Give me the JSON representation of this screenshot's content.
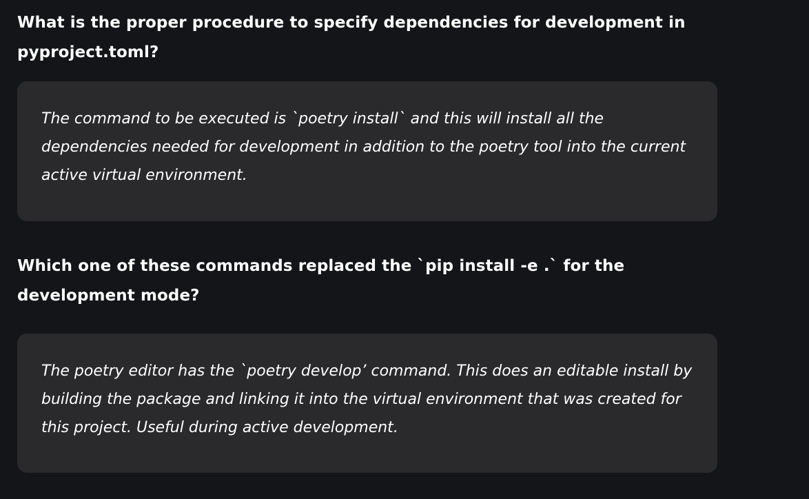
{
  "qa": [
    {
      "question": "What is the proper procedure to specify dependencies for development in pyproject.toml?",
      "answer": "The command to be executed is `poetry install` and this will install all the dependencies needed for development in addition to the poetry tool into the current active virtual environment."
    },
    {
      "question": "Which one of these commands replaced the `pip install -e .` for the development mode?",
      "answer": "The poetry editor has the `poetry develop’ command. This does an editable install by building the package and linking it into the virtual environment that was created for this project. Useful during active development."
    }
  ]
}
